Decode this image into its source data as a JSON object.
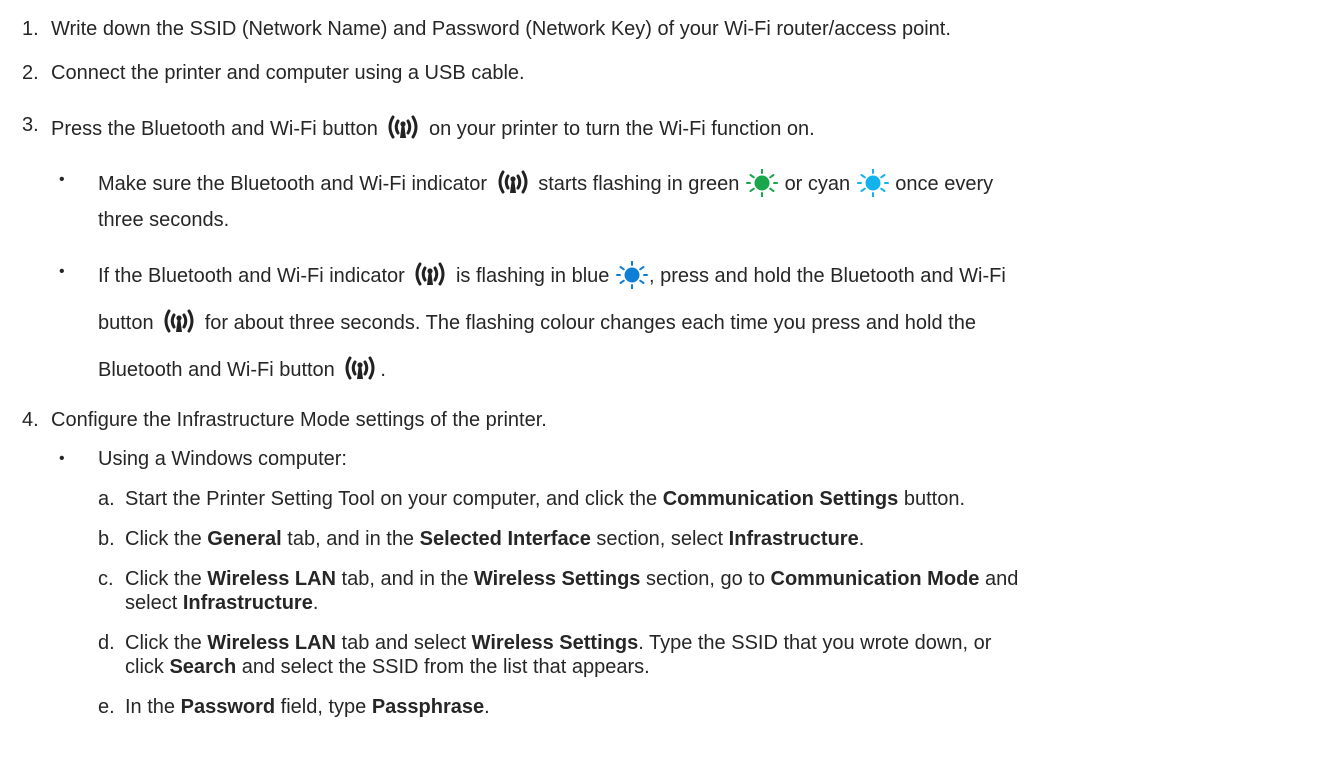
{
  "colors": {
    "text": "#262626",
    "green": "#1aa64b",
    "cyan": "#12b3ec",
    "blue": "#0f7fd6",
    "icon": "#222222"
  },
  "icons": {
    "wifi": "bluetooth-wifi-button-icon",
    "led": "flashing-led-icon"
  },
  "steps": [
    {
      "num": "1.",
      "text": "Write down the SSID (Network Name) and Password (Network Key) of your Wi-Fi router/access point."
    },
    {
      "num": "2.",
      "text": "Connect the printer and computer using a USB cable."
    },
    {
      "num": "3.",
      "a": "Press the Bluetooth and Wi-Fi button",
      "b": "on your printer to turn the Wi-Fi function on."
    },
    {
      "num": "4.",
      "text": "Configure the Infrastructure Mode settings of the printer."
    }
  ],
  "step3_bullets": {
    "b1": {
      "a": "Make sure the Bluetooth and Wi-Fi indicator",
      "b": "starts flashing in green",
      "c": "or cyan",
      "d": "once every",
      "e": "three seconds."
    },
    "b2": {
      "a": "If the Bluetooth and Wi-Fi indicator",
      "b": "is flashing in blue",
      "c": ", press and hold the Bluetooth and Wi-Fi",
      "d": "button",
      "e": "for about three seconds. The flashing colour changes each time you press and hold the",
      "f": "Bluetooth and Wi-Fi button",
      "g": "."
    }
  },
  "bullet_char": "•",
  "step4": {
    "windows": "Using a Windows computer:",
    "a": {
      "letter": "a.",
      "t1": "Start the Printer Setting Tool on your computer, and click the ",
      "b1": "Communication Settings",
      "t2": " button."
    },
    "b": {
      "letter": "b.",
      "t1": "Click the ",
      "b1": "General",
      "t2": " tab, and in the ",
      "b2": "Selected Interface",
      "t3": " section, select ",
      "b3": "Infrastructure",
      "t4": "."
    },
    "c": {
      "letter": "c.",
      "t1": "Click the ",
      "b1": "Wireless LAN",
      "t2": " tab, and in the ",
      "b2": "Wireless Settings",
      "t3": " section, go to ",
      "b3": "Communication Mode",
      "t4": " and",
      "t5": "select ",
      "b4": "Infrastructure",
      "t6": "."
    },
    "d": {
      "letter": "d.",
      "t1": "Click the ",
      "b1": "Wireless LAN",
      "t2": " tab and select ",
      "b2": "Wireless Settings",
      "t3": ". Type the SSID that you wrote down, or",
      "t4": "click ",
      "b3": "Search",
      "t5": " and select the SSID from the list that appears."
    },
    "e": {
      "letter": "e.",
      "t1": "In the ",
      "b1": "Password",
      "t2": " field, type ",
      "b2": "Passphrase",
      "t3": "."
    }
  }
}
